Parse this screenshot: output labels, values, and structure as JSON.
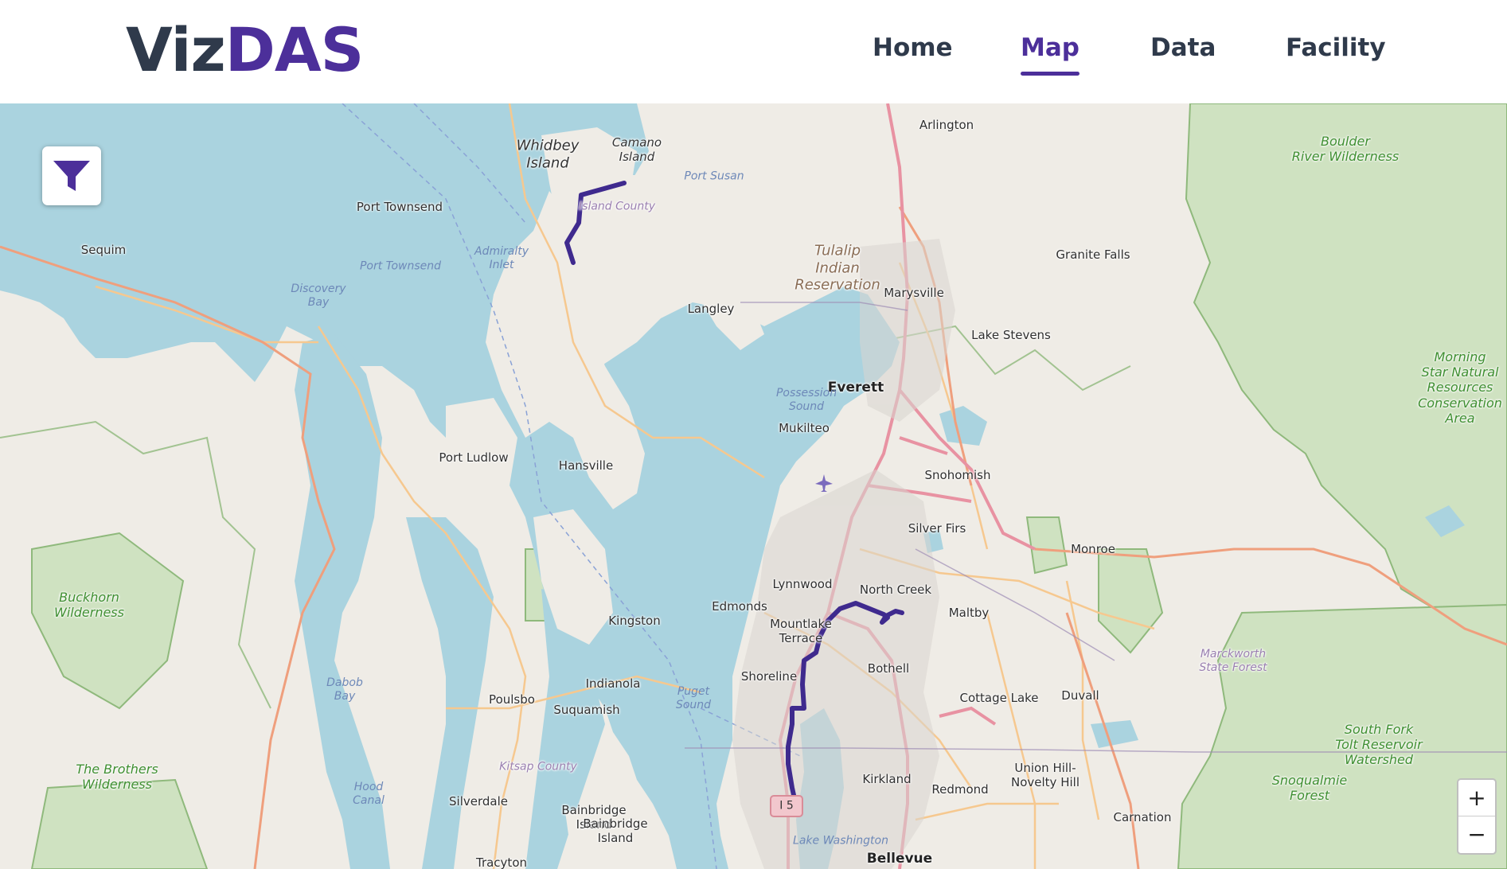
{
  "header": {
    "logo_part1": "Viz",
    "logo_part2": "DAS",
    "nav": [
      {
        "label": "Home",
        "active": false
      },
      {
        "label": "Map",
        "active": true
      },
      {
        "label": "Data",
        "active": false
      },
      {
        "label": "Facility",
        "active": false
      }
    ]
  },
  "map": {
    "filter_icon": "filter-funnel-icon",
    "zoom_in_label": "+",
    "zoom_out_label": "−",
    "highway_shield": "I 5",
    "colors": {
      "accent": "#4c2f9a",
      "water": "#aad3df",
      "land": "#efece6",
      "park": "#add19e",
      "motorway": "#e892a2",
      "road": "#f6c88f",
      "route": "#3f2a8e"
    },
    "labels": {
      "whidbey": "Whidbey\nIsland",
      "camano": "Camano\nIsland",
      "port_susan": "Port Susan",
      "island_county": "Island County",
      "port_townsend_city": "Port Townsend",
      "sequim": "Sequim",
      "port_townsend_bay": "Port Townsend",
      "admiralty_inlet": "Admiralty\nInlet",
      "discovery_bay": "Discovery\nBay",
      "langley": "Langley",
      "tulalip": "Tulalip\nIndian\nReservation",
      "arlington": "Arlington",
      "marysville": "Marysville",
      "lake_stevens": "Lake Stevens",
      "granite_falls": "Granite Falls",
      "boulder": "Boulder\nRiver Wilderness",
      "morning_star": "Morning\nStar Natural\nResources\nConservation\nArea",
      "everett": "Everett",
      "possession_sound": "Possession\nSound",
      "mukilteo": "Mukilteo",
      "snohomish": "Snohomish",
      "port_ludlow": "Port Ludlow",
      "hansville": "Hansville",
      "silver_firs": "Silver Firs",
      "monroe": "Monroe",
      "buckhorn": "Buckhorn\nWilderness",
      "lynnwood": "Lynnwood",
      "north_creek": "North Creek",
      "edmonds": "Edmonds",
      "mountlake": "Mountlake\nTerrace",
      "maltby": "Maltby",
      "kingston": "Kingston",
      "marckworth": "Marckworth\nState Forest",
      "dabob": "Dabob\nBay",
      "bothell": "Bothell",
      "shoreline": "Shoreline",
      "cottage_lake": "Cottage Lake",
      "duvall": "Duvall",
      "indianola": "Indianola",
      "poulsbo": "Poulsbo",
      "puget_sound": "Puget\nSound",
      "suquamish": "Suquamish",
      "south_fork": "South Fork\nTolt Reservoir\nWatershed",
      "brothers": "The Brothers\nWilderness",
      "kitsap": "Kitsap County",
      "kirkland": "Kirkland",
      "union_hill": "Union Hill-\nNovelty Hill",
      "redmond": "Redmond",
      "snoqualmie": "Snoqualmie\nForest",
      "hood_canal": "Hood\nCanal",
      "silverdale": "Silverdale",
      "bainbridge_island_region": "Bainbridge\nIsland",
      "bainbridge_island_city": "Bainbridge\nIsland",
      "carnation": "Carnation",
      "lake_washington": "Lake Washington",
      "bellevue": "Bellevue",
      "tracyton": "Tracyton"
    }
  }
}
